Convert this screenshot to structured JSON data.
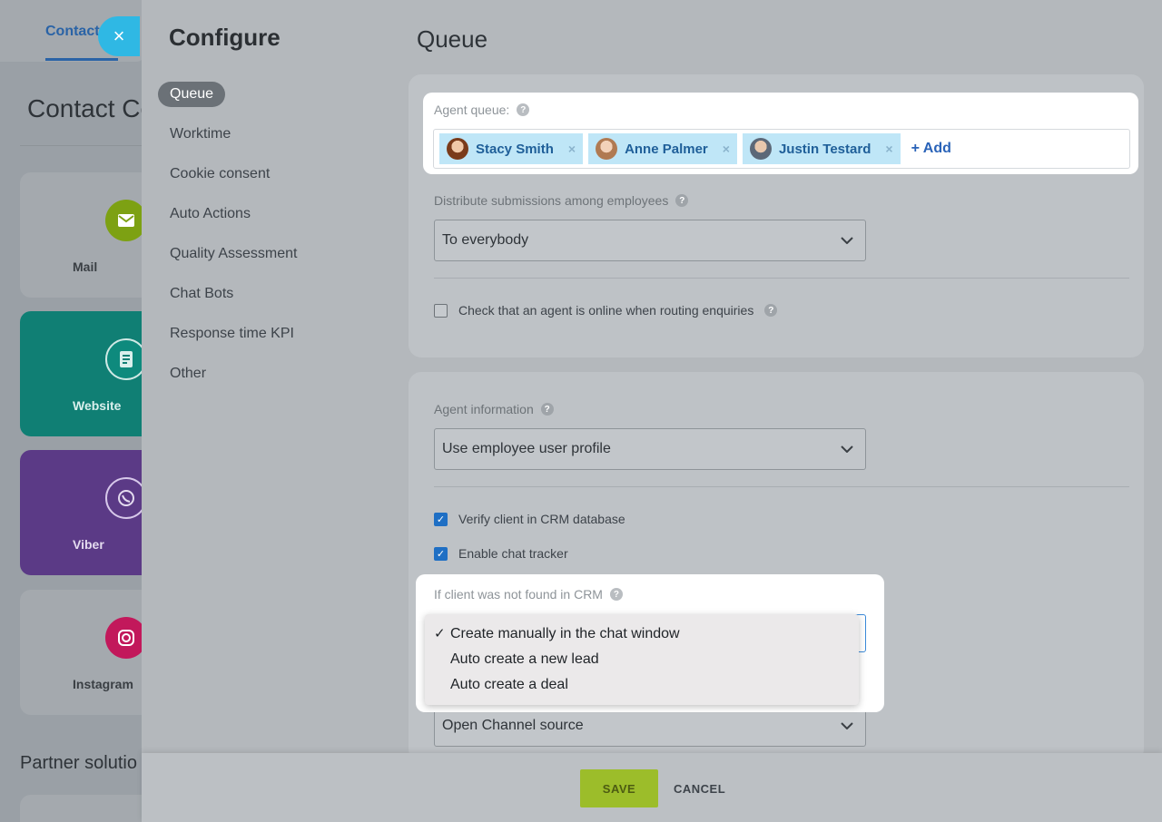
{
  "background": {
    "tab_label": "Contact",
    "title": "Contact Ce",
    "tiles": [
      {
        "label": "Mail",
        "icon": "mail-icon",
        "color": "#7da113",
        "bg": "#a4a9ae",
        "label_color": "#3a3f44"
      },
      {
        "label": "Website",
        "icon": "document-icon",
        "color": "#0e8a7d",
        "bg": "#107f74",
        "label_color": "#d9efec"
      },
      {
        "label": "Viber",
        "icon": "viber-icon",
        "color": "#5b3a86",
        "bg": "#5b3a86",
        "label_color": "#e4dbef"
      },
      {
        "label": "Instagram",
        "icon": "instagram-icon",
        "color": "#c2185b",
        "bg": "#a4a9ae",
        "label_color": "#3a3f44"
      }
    ],
    "partner_title": "Partner solutio"
  },
  "slider": {
    "title": "Configure",
    "menu": [
      {
        "label": "Queue",
        "active": true
      },
      {
        "label": "Worktime"
      },
      {
        "label": "Cookie consent"
      },
      {
        "label": "Auto Actions"
      },
      {
        "label": "Quality Assessment"
      },
      {
        "label": "Chat Bots"
      },
      {
        "label": "Response time KPI"
      },
      {
        "label": "Other"
      }
    ],
    "page_title": "Queue"
  },
  "queue": {
    "agent_queue_label": "Agent queue:",
    "agents": [
      {
        "name": "Stacy Smith",
        "avatar_color": "#a0522d"
      },
      {
        "name": "Anne Palmer",
        "avatar_color": "#c8956d"
      },
      {
        "name": "Justin Testard",
        "avatar_color": "#6d7a8a"
      }
    ],
    "add_label": "+ Add",
    "remove_glyph": "×",
    "distribute_label": "Distribute submissions among employees",
    "distribute_value": "To everybody",
    "online_check_label": "Check that an agent is online when routing enquiries",
    "online_check_checked": false
  },
  "agent_info": {
    "label": "Agent information",
    "value": "Use employee user profile",
    "verify_label": "Verify client in CRM database",
    "verify_checked": true,
    "tracker_label": "Enable chat tracker",
    "tracker_checked": true,
    "not_found_label": "If client was not found in CRM",
    "not_found_options": [
      {
        "label": "Create manually in the chat window",
        "selected": true
      },
      {
        "label": "Auto create a new lead"
      },
      {
        "label": "Auto create a deal"
      }
    ],
    "source_value": "Open Channel source"
  },
  "footer": {
    "save_label": "SAVE",
    "cancel_label": "CANCEL"
  },
  "glyphs": {
    "close": "×",
    "chevron": "⌄",
    "check": "✓",
    "help": "?"
  }
}
